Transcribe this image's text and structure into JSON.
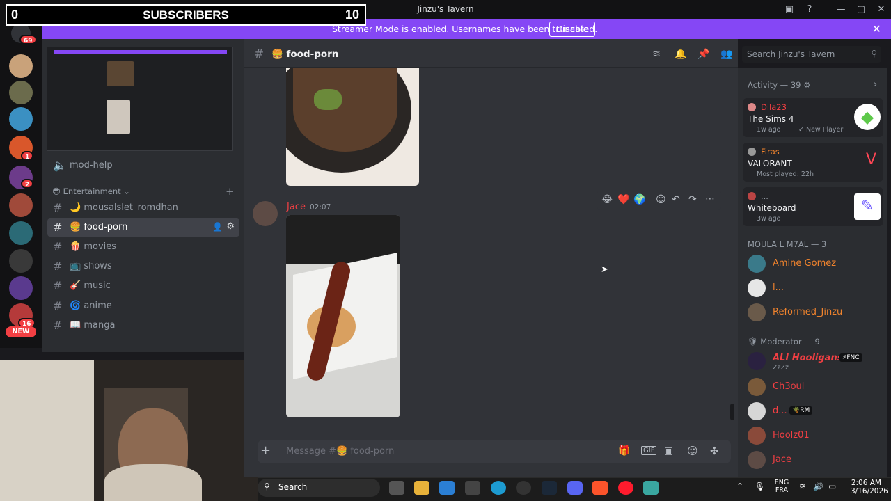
{
  "overlay": {
    "left_count": "0",
    "label": "SUBSCRIBERS",
    "right_count": "10"
  },
  "window": {
    "title": "Jinzu's Tavern"
  },
  "banner": {
    "text": "Streamer Mode is enabled. Usernames have been truncated.",
    "button": "Disable"
  },
  "rail": {
    "badges": [
      "69",
      "1",
      "2",
      "16"
    ],
    "new_label": "NEW"
  },
  "sidebar": {
    "mod_help": "mod-help",
    "category": "Entertainment",
    "channels": [
      {
        "emoji": "🌙",
        "name": "mousalslet_romdhan"
      },
      {
        "emoji": "🍔",
        "name": "food-porn"
      },
      {
        "emoji": "🍿",
        "name": "movies"
      },
      {
        "emoji": "📺",
        "name": "shows"
      },
      {
        "emoji": "🎸",
        "name": "music"
      },
      {
        "emoji": "🌀",
        "name": "anime"
      },
      {
        "emoji": "📖",
        "name": "manga"
      }
    ]
  },
  "chat": {
    "channel_title": "🍔 food-porn",
    "search_placeholder": "Search Jinzu's Tavern",
    "message": {
      "author": "Jace",
      "time": "02:07"
    },
    "reactions": [
      "😂",
      "❤️",
      "🌍"
    ],
    "composer_placeholder": "Message #🍔 food-porn"
  },
  "members": {
    "activity_label": "Activity — 39",
    "activities": [
      {
        "user": "Dila23",
        "game": "The Sims 4",
        "detail": "1w ago",
        "tag": "New Player"
      },
      {
        "user": "Firas",
        "game": "VALORANT",
        "detail": "Most played: 22h"
      },
      {
        "user": "...",
        "game": "Whiteboard",
        "detail": "3w ago"
      }
    ],
    "group1_label": "MOULA L M7AL — 3",
    "group1": [
      {
        "name": "Amine Gomez",
        "color": "#f0832d"
      },
      {
        "name": "l...",
        "color": "#f0832d"
      },
      {
        "name": "Reformed_Jinzu",
        "color": "#f0832d"
      }
    ],
    "group2_label": "Moderator — 9",
    "group2": [
      {
        "name": "ALI Hooligans",
        "color": "#f23f43",
        "tag": "FNC",
        "sub": "ZzZz"
      },
      {
        "name": "Ch3oul",
        "color": "#f23f43"
      },
      {
        "name": "d...",
        "color": "#f23f43",
        "tag": "RM"
      },
      {
        "name": "Hoolz01",
        "color": "#f23f43"
      },
      {
        "name": "Jace",
        "color": "#f23f43"
      }
    ]
  },
  "taskbar": {
    "search": "Search",
    "lang1": "ENG",
    "lang2": "FRA",
    "time": "2:06 AM",
    "date": "3/16/2026"
  }
}
